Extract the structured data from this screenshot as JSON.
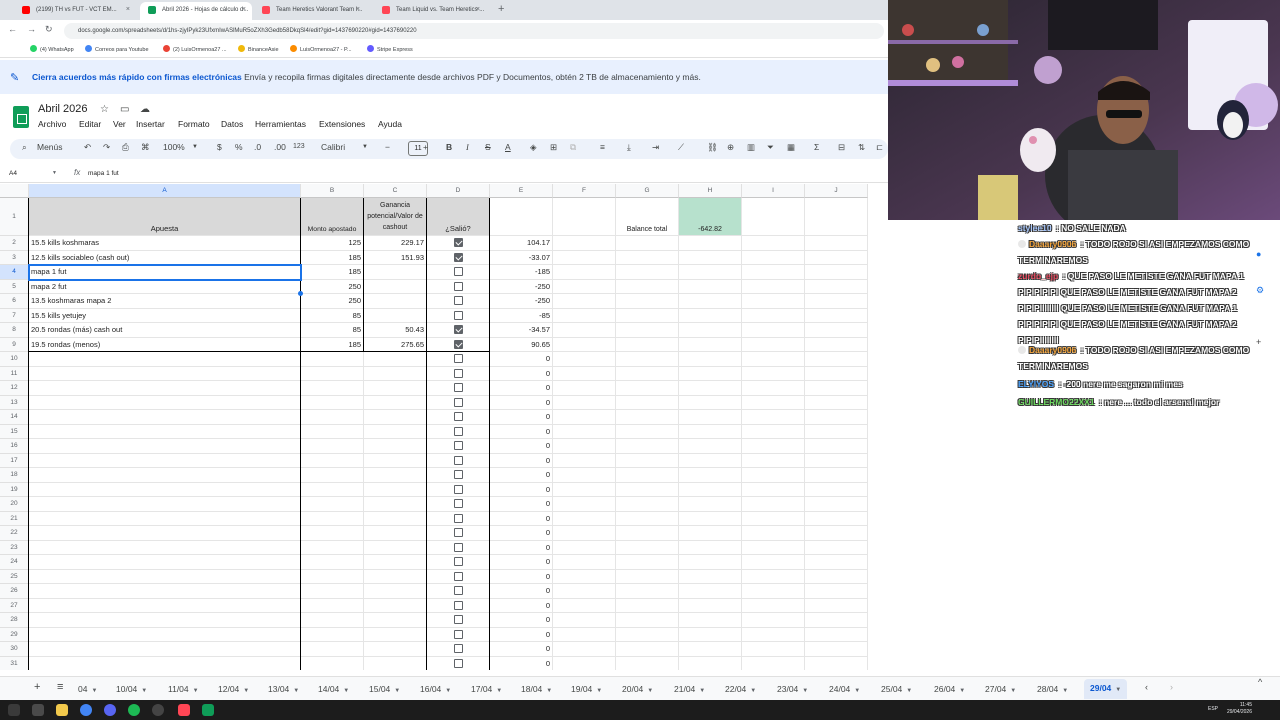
{
  "browser": {
    "tabs": [
      {
        "label": "(2199) TH vs FUT - VCT EM...",
        "color": "#ff0000",
        "active": false
      },
      {
        "label": "Abril 2026 - Hojas de cálculo d...",
        "color": "#0f9d58",
        "active": true
      },
      {
        "label": "Team Heretics Valorant Team I...",
        "color": "#ff4655",
        "active": false
      },
      {
        "label": "Team Liquid vs. Team Heretics ...",
        "color": "#ff4655",
        "active": false
      }
    ],
    "url": "docs.google.com/spreadsheets/d/1hs-zjyIPyk23UfxmIwASlMuR5oZXh3Gedb58DkqSl4/edit?gid=1437690220#gid=1437690220",
    "bookmarks": [
      {
        "label": "(4) WhatsApp",
        "color": "#25d366"
      },
      {
        "label": "Correos para Youtube",
        "color": "#4285f4"
      },
      {
        "label": "(2) LuisOrmenoa27 ...",
        "color": "#ea4335"
      },
      {
        "label": "BinanceAsie",
        "color": "#f0b90b"
      },
      {
        "label": "LuisOrmenoa27 - P...",
        "color": "#fb8c00"
      },
      {
        "label": "Stripe Express",
        "color": "#635bff"
      }
    ]
  },
  "banner": {
    "bold": "Cierra acuerdos más rápido con firmas electrónicas",
    "text": " Envía y recopila firmas digitales directamente desde archivos PDF y Documentos, obtén 2 TB de almacenamiento y más."
  },
  "doc": {
    "title": "Abril 2026",
    "menu": [
      "Archivo",
      "Editar",
      "Ver",
      "Insertar",
      "Formato",
      "Datos",
      "Herramientas",
      "Extensiones",
      "Ayuda"
    ]
  },
  "toolbar": {
    "menus_label": "Menús",
    "zoom": "100%",
    "currency": "$",
    "percent": "%",
    "dec_less": ".0",
    "dec_more": ".00",
    "number_format": "123",
    "font": "Calibri",
    "font_size": "11",
    "bold": "B",
    "italic": "I",
    "text_color": "A"
  },
  "formula_bar": {
    "cell_ref": "A4",
    "content": "mapa 1 fut"
  },
  "columns": [
    "A",
    "B",
    "C",
    "D",
    "E",
    "F",
    "G",
    "H",
    "I",
    "J"
  ],
  "headers": {
    "apuesta": "Apuesta",
    "monto": "Monto apostado",
    "ganancia": "Ganancia potencial/Valor de cashout",
    "salio": "¿Salió?"
  },
  "balance": {
    "label": "Balance total",
    "value": "-642.82"
  },
  "rows": [
    {
      "n": "2",
      "apuesta": "15.5 kills koshmaras",
      "monto": "125",
      "ganancia": "229.17",
      "checked": true,
      "resultado": "104.17"
    },
    {
      "n": "3",
      "apuesta": "12.5 kills sociableo (cash out)",
      "monto": "185",
      "ganancia": "151.93",
      "checked": true,
      "resultado": "-33.07"
    },
    {
      "n": "4",
      "apuesta": "mapa 1 fut",
      "monto": "185",
      "ganancia": "",
      "checked": false,
      "resultado": "-185"
    },
    {
      "n": "5",
      "apuesta": "mapa 2 fut",
      "monto": "250",
      "ganancia": "",
      "checked": false,
      "resultado": "-250"
    },
    {
      "n": "6",
      "apuesta": "13.5 koshmaras mapa 2",
      "monto": "250",
      "ganancia": "",
      "checked": false,
      "resultado": "-250"
    },
    {
      "n": "7",
      "apuesta": "15.5 kills yetujey",
      "monto": "85",
      "ganancia": "",
      "checked": false,
      "resultado": "-85"
    },
    {
      "n": "8",
      "apuesta": "20.5 rondas (más) cash out",
      "monto": "85",
      "ganancia": "50.43",
      "checked": true,
      "resultado": "-34.57"
    },
    {
      "n": "9",
      "apuesta": "19.5 rondas (menos)",
      "monto": "185",
      "ganancia": "275.65",
      "checked": true,
      "resultado": "90.65"
    }
  ],
  "empty_rows": [
    "10",
    "11",
    "12",
    "13",
    "14",
    "15",
    "16",
    "17",
    "18",
    "19",
    "20",
    "21",
    "22",
    "23",
    "24",
    "25",
    "26",
    "27",
    "28",
    "29",
    "30",
    "31"
  ],
  "empty_result": "0",
  "sheet_tabs": [
    "04",
    "10/04",
    "11/04",
    "12/04",
    "13/04",
    "14/04",
    "15/04",
    "16/04",
    "17/04",
    "18/04",
    "19/04",
    "20/04",
    "21/04",
    "22/04",
    "23/04",
    "24/04",
    "25/04",
    "26/04",
    "27/04",
    "28/04",
    "29/04"
  ],
  "active_sheet": "29/04",
  "chat": [
    {
      "user": "stylee10",
      "color": "#a8c7fa",
      "text": "NO SALE NADA",
      "badge": false
    },
    {
      "user": "Daaary0906",
      "color": "#f2a33a",
      "text": "TODO ROJO SI ASI EMPEZAMOS COMO TERMINAREMOS",
      "badge": true
    },
    {
      "user": "zurdo_ejp",
      "color": "#e84a5f",
      "text": "QUE PASO LE METISTE GANA FUT MAPA 1 PIPIPIPIPI QUE PASO LE METISTE GANA FUT MAPA 2 PIPIPIIIIIIII QUE PASO LE METISTE GANA FUT MAPA 1 PIPIPIPIPI QUE PASO LE METISTE GANA FUT MAPA 2 PIPIPIIIIIIII",
      "badge": false
    },
    {
      "user": "Daaary0906",
      "color": "#f2a33a",
      "text": "TODO ROJO SI ASI EMPEZAMOS COMO TERMINAREMOS",
      "badge": true
    },
    {
      "user": "ELYIYOS",
      "color": "#4aa3ff",
      "text": "-200 nere me sagaron mi mes",
      "badge": false
    },
    {
      "user": "GUILLERMO22XX1",
      "color": "#6cd75f",
      "text": "nere ... todo el arsenal mejor",
      "badge": false
    }
  ],
  "taskbar": {
    "lang": "ESP",
    "time": "11:45",
    "date": "29/04/2026"
  }
}
